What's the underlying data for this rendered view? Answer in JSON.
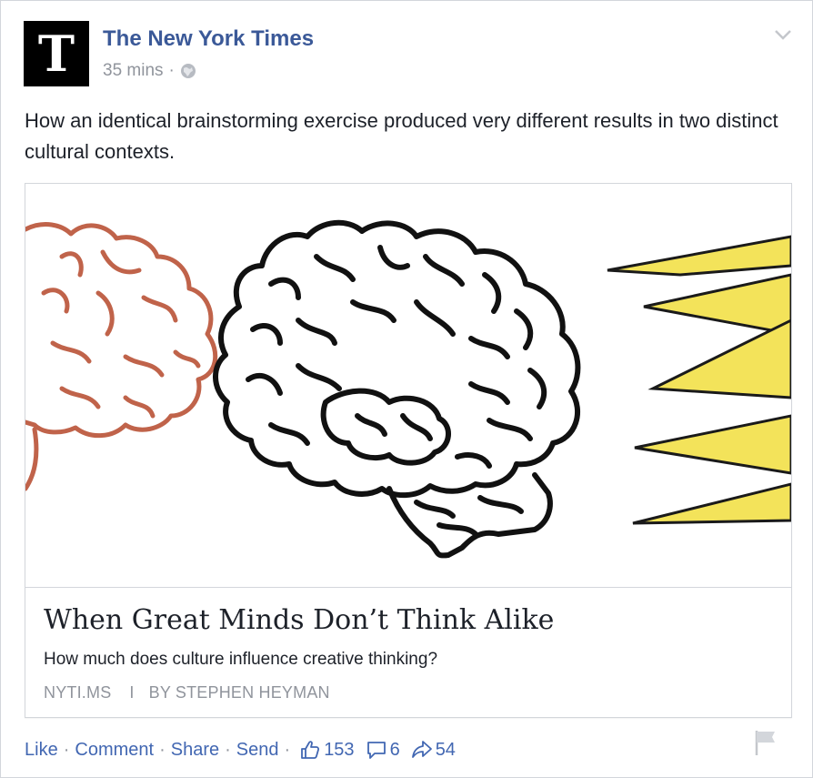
{
  "post": {
    "page_name": "The New York Times",
    "avatar_letter": "T",
    "time": "35 mins",
    "meta_separator": "·",
    "text": "How an identical brainstorming exercise produced very different results in two distinct cultural contexts."
  },
  "link": {
    "title": "When Great Minds Don’t Think Alike",
    "description": "How much does culture influence creative thinking?",
    "domain": "NYTI.MS",
    "separator": "I",
    "byline": "BY STEPHEN HEYMAN"
  },
  "actions": {
    "like": "Like",
    "comment": "Comment",
    "share": "Share",
    "send": "Send",
    "dot": "·",
    "likes_count": "153",
    "comments_count": "6",
    "shares_count": "54"
  },
  "colors": {
    "link_blue": "#3b5998",
    "action_blue": "#4267b2",
    "muted": "#90949c",
    "brain_red": "#c0634a",
    "burst_yellow": "#f3e35a"
  },
  "icons": [
    "nyt-logo-icon",
    "globe-icon",
    "chevron-down-icon",
    "like-icon",
    "comment-icon",
    "share-icon",
    "flag-icon"
  ]
}
